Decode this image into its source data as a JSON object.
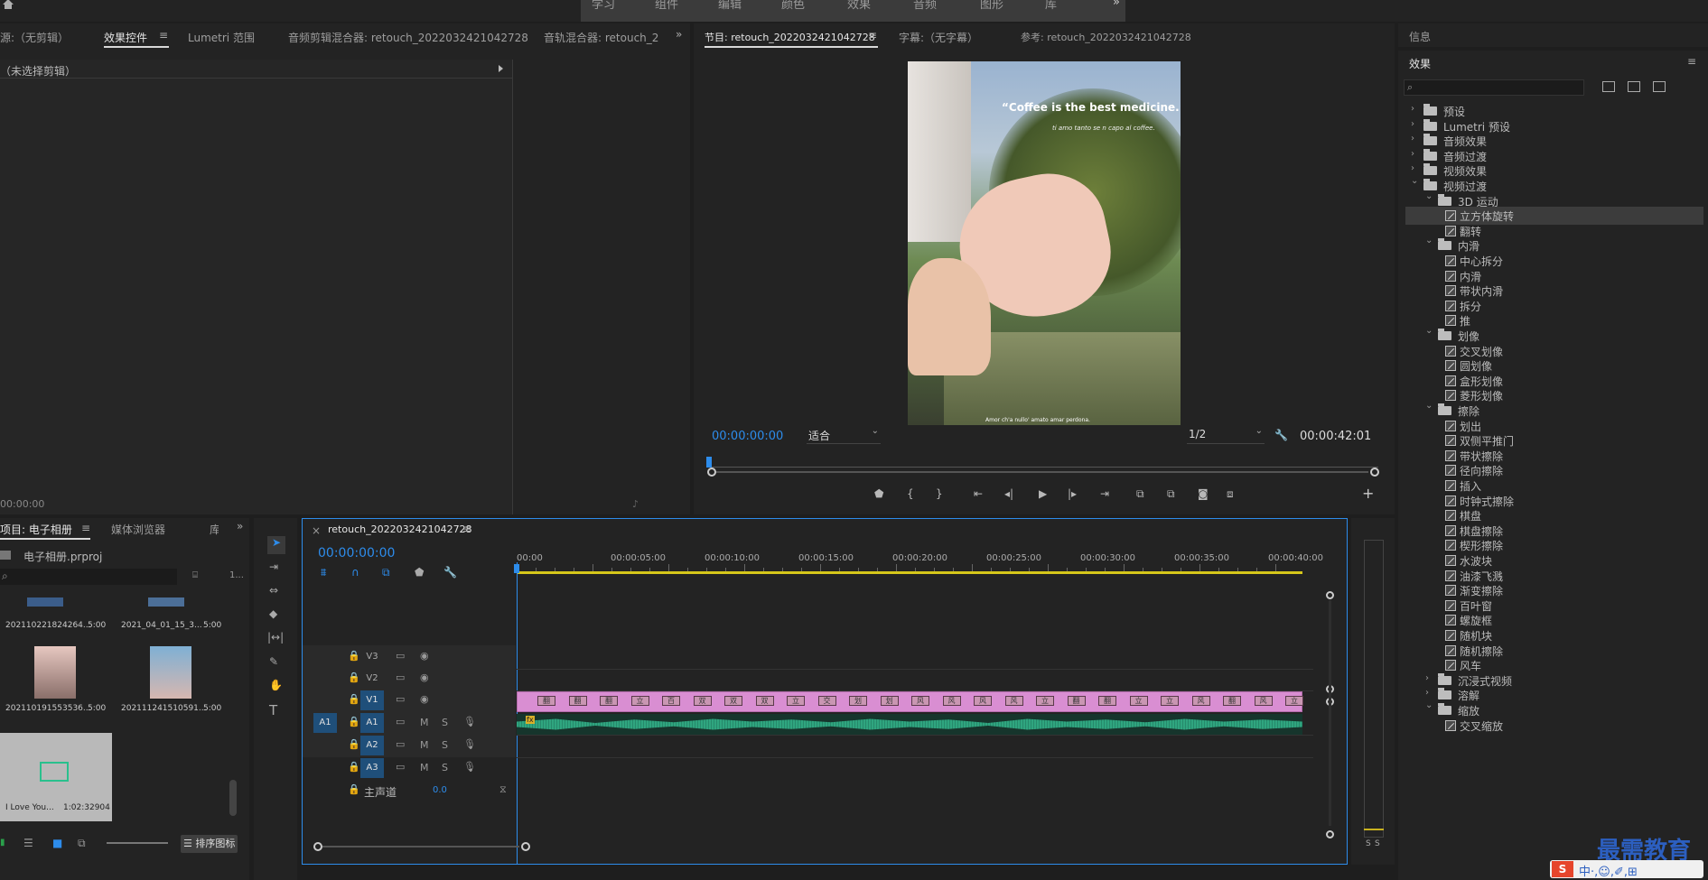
{
  "workspaces": [
    "学习",
    "组件",
    "编辑",
    "颜色",
    "效果",
    "音频",
    "图形",
    "库"
  ],
  "workspace_more": "»",
  "source_panel": {
    "tabs": [
      "源:（无剪辑）",
      "效果控件",
      "Lumetri 范围",
      "音频剪辑混合器: retouch_20220324210427​28",
      "音轨混合器: retouch_2"
    ],
    "active_tab": "效果控件",
    "menu_icon": "≡",
    "overflow": "»",
    "no_clip": "（未选择剪辑）",
    "timecode": "00:00:00"
  },
  "program_panel": {
    "tabs": [
      "节目: retouch_2022032421042728",
      "字幕:（无字幕）",
      "参考: retouch_2022032421042728"
    ],
    "active_tab": "节目: retouch_2022032421042728",
    "menu_icon": "≡",
    "video_title": "“Coffee is the best medicine.”",
    "video_script": "ti amo tanto se n capo al coffee.",
    "video_caption": "Amor ch'a nullo' amato amar perdona.",
    "timecode": "00:00:00:00",
    "fit": "适合",
    "quality": "1/2",
    "duration": "00:00:42:01",
    "add": "+"
  },
  "info_panel": {
    "title": "信息"
  },
  "effects_panel": {
    "title": "效果",
    "menu_icon": "≡",
    "search_placeholder": "",
    "tree": [
      {
        "type": "folder",
        "label": "预设",
        "level": 0,
        "open": false
      },
      {
        "type": "folder",
        "label": "Lumetri 预设",
        "level": 0,
        "open": false
      },
      {
        "type": "folder",
        "label": "音频效果",
        "level": 0,
        "open": false
      },
      {
        "type": "folder",
        "label": "音频过渡",
        "level": 0,
        "open": false
      },
      {
        "type": "folder",
        "label": "视频效果",
        "level": 0,
        "open": false
      },
      {
        "type": "folder",
        "label": "视频过渡",
        "level": 0,
        "open": true
      },
      {
        "type": "folder",
        "label": "3D 运动",
        "level": 1,
        "open": true
      },
      {
        "type": "fx",
        "label": "立方体旋转",
        "level": 2,
        "selected": true
      },
      {
        "type": "fx",
        "label": "翻转",
        "level": 2
      },
      {
        "type": "folder",
        "label": "内滑",
        "level": 1,
        "open": true
      },
      {
        "type": "fx",
        "label": "中心拆分",
        "level": 2
      },
      {
        "type": "fx",
        "label": "内滑",
        "level": 2
      },
      {
        "type": "fx",
        "label": "带状内滑",
        "level": 2
      },
      {
        "type": "fx",
        "label": "拆分",
        "level": 2
      },
      {
        "type": "fx",
        "label": "推",
        "level": 2
      },
      {
        "type": "folder",
        "label": "划像",
        "level": 1,
        "open": true
      },
      {
        "type": "fx",
        "label": "交叉划像",
        "level": 2
      },
      {
        "type": "fx",
        "label": "圆划像",
        "level": 2
      },
      {
        "type": "fx",
        "label": "盒形划像",
        "level": 2
      },
      {
        "type": "fx",
        "label": "菱形划像",
        "level": 2
      },
      {
        "type": "folder",
        "label": "擦除",
        "level": 1,
        "open": true
      },
      {
        "type": "fx",
        "label": "划出",
        "level": 2
      },
      {
        "type": "fx",
        "label": "双侧平推门",
        "level": 2
      },
      {
        "type": "fx",
        "label": "带状擦除",
        "level": 2
      },
      {
        "type": "fx",
        "label": "径向擦除",
        "level": 2
      },
      {
        "type": "fx",
        "label": "插入",
        "level": 2
      },
      {
        "type": "fx",
        "label": "时钟式擦除",
        "level": 2
      },
      {
        "type": "fx",
        "label": "棋盘",
        "level": 2
      },
      {
        "type": "fx",
        "label": "棋盘擦除",
        "level": 2
      },
      {
        "type": "fx",
        "label": "楔形擦除",
        "level": 2
      },
      {
        "type": "fx",
        "label": "水波块",
        "level": 2
      },
      {
        "type": "fx",
        "label": "油漆飞溅",
        "level": 2
      },
      {
        "type": "fx",
        "label": "渐变擦除",
        "level": 2
      },
      {
        "type": "fx",
        "label": "百叶窗",
        "level": 2
      },
      {
        "type": "fx",
        "label": "螺旋框",
        "level": 2
      },
      {
        "type": "fx",
        "label": "随机块",
        "level": 2
      },
      {
        "type": "fx",
        "label": "随机擦除",
        "level": 2
      },
      {
        "type": "fx",
        "label": "风车",
        "level": 2
      },
      {
        "type": "folder",
        "label": "沉浸式视频",
        "level": 1,
        "open": false
      },
      {
        "type": "folder",
        "label": "溶解",
        "level": 1,
        "open": false
      },
      {
        "type": "folder",
        "label": "缩放",
        "level": 1,
        "open": true
      },
      {
        "type": "fx",
        "label": "交叉缩放",
        "level": 2
      }
    ]
  },
  "project_panel": {
    "tabs": [
      "项目: 电子相册",
      "媒体浏览器",
      "库"
    ],
    "menu_icon": "≡",
    "overflow": "»",
    "project_file": "电子相册.prproj",
    "count": "1...",
    "items": [
      {
        "name": "20211022182426​4...",
        "dur": "5:00"
      },
      {
        "name": "2021_04_01_15_3...",
        "dur": "5:00"
      },
      {
        "name": "20211019155353​6...",
        "dur": "5:00"
      },
      {
        "name": "20211124151059​1...",
        "dur": "5:00"
      },
      {
        "name": "I Love You...",
        "dur": "1:02:32904"
      }
    ],
    "sort_label": "排序图标"
  },
  "timeline": {
    "close": "×",
    "title": "retouch_2022032421042728",
    "menu_icon": "≡",
    "timecode": "00:00:00:00",
    "ruler": [
      "00:00",
      "00:00:05:00",
      "00:00:10:00",
      "00:00:15:00",
      "00:00:20:00",
      "00:00:25:00",
      "00:00:30:00",
      "00:00:35:00",
      "00:00:40:00"
    ],
    "video_tracks": [
      "V3",
      "V2",
      "V1"
    ],
    "audio_tracks": [
      "A1",
      "A2",
      "A3"
    ],
    "source_patch": "A1",
    "master_label": "主声道",
    "master_value": "0.0",
    "mute": "M",
    "solo": "S",
    "clip_fx": "fx",
    "transition_labels": [
      "翻",
      "翻",
      "翻",
      "立",
      "百",
      "双",
      "双",
      "双",
      "立",
      "交",
      "划",
      "划",
      "风",
      "风",
      "风",
      "风",
      "立",
      "翻",
      "翻",
      "立",
      "立",
      "风",
      "翻",
      "风",
      "立"
    ]
  },
  "meter": {
    "labels": [
      "S",
      "S"
    ]
  },
  "watermark": {
    "brand": "最需教育",
    "ime": "中·,☺,✐,⊞"
  },
  "colors": {
    "accent": "#2d8ceb",
    "clip_video": "#d98ed2",
    "clip_audio": "#2fa57f",
    "selected_track": "#1f4f7a"
  }
}
